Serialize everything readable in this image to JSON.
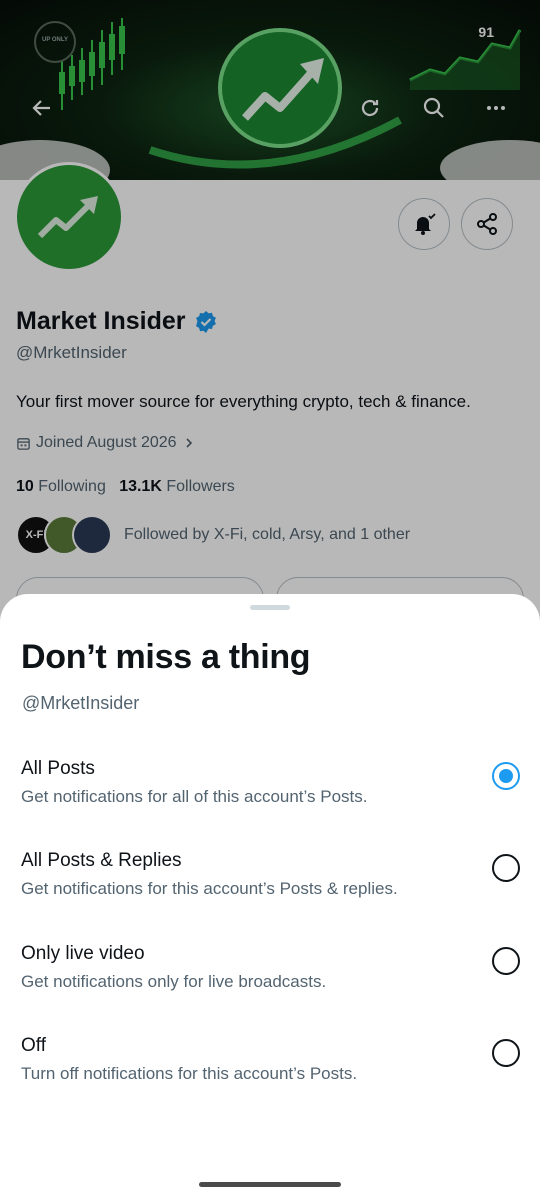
{
  "banner": {
    "badge_number": "91",
    "up_only_text": "UP ONLY",
    "icons": {
      "back": "back-arrow-icon",
      "refresh": "refresh-icon",
      "search": "search-icon",
      "more": "more-icon"
    }
  },
  "profile": {
    "display_name": "Market Insider",
    "verified": true,
    "handle": "@MrketInsider",
    "bio": "Your first mover source for everything crypto, tech & finance.",
    "joined": "Joined August 2026",
    "following_count": "10",
    "following_label": "Following",
    "followers_count": "13.1K",
    "followers_label": "Followers",
    "followed_by": "Followed by X-Fi, cold, Arsy, and 1 other",
    "mini_avatar_label": "X-Fi"
  },
  "sheet": {
    "title": "Don’t miss a thing",
    "handle": "@MrketInsider",
    "options": [
      {
        "title": "All Posts",
        "description": "Get notifications for all of this account’s Posts.",
        "selected": true
      },
      {
        "title": "All Posts & Replies",
        "description": "Get notifications for this account’s Posts & replies.",
        "selected": false
      },
      {
        "title": "Only live video",
        "description": "Get notifications only for live broadcasts.",
        "selected": false
      },
      {
        "title": "Off",
        "description": "Turn off notifications for this account’s Posts.",
        "selected": false
      }
    ]
  },
  "colors": {
    "accent": "#1d9bf0",
    "brand_green": "#2c9a3a",
    "text_primary": "#0f1419",
    "text_secondary": "#536471"
  }
}
